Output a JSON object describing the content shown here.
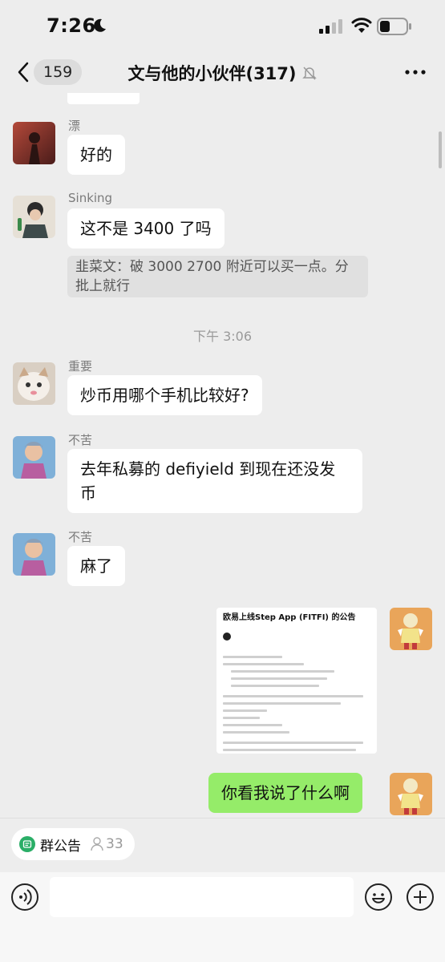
{
  "status_bar": {
    "time": "7:26"
  },
  "nav": {
    "back_count": "159",
    "title": "文与他的小伙伴(317)"
  },
  "messages": [
    {
      "sender": "漂",
      "text": "好的"
    },
    {
      "sender": "Sinking",
      "text": "这不是 3400 了吗",
      "quote": "韭菜文：破 3000 2700 附近可以买一点。分批上就行"
    },
    {
      "timestamp": "下午 3:06"
    },
    {
      "sender": "重要",
      "text": "炒币用哪个手机比较好?"
    },
    {
      "sender": "不苦",
      "text": "去年私募的 defiyield 到现在还没发币"
    },
    {
      "sender": "不苦",
      "text": "麻了"
    }
  ],
  "image_message": {
    "title": "欧易上线Step App (FITFI) 的公告"
  },
  "my_message": {
    "text": "你看我说了什么啊"
  },
  "notice": {
    "label": "群公告",
    "count": "33"
  },
  "colors": {
    "my_bubble": "#95ec69",
    "background": "#ededed",
    "notice_green": "#2aae67"
  }
}
